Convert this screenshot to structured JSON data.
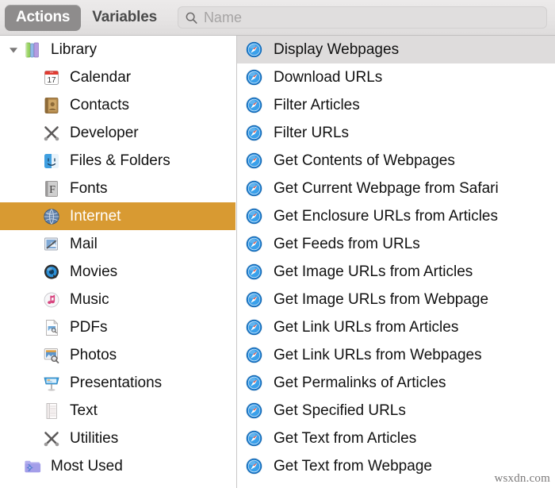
{
  "toolbar": {
    "tabs": [
      {
        "label": "Actions",
        "selected": true
      },
      {
        "label": "Variables",
        "selected": false
      }
    ],
    "search": {
      "placeholder": "Name",
      "value": "",
      "icon": "search-icon"
    }
  },
  "sidebar": {
    "items": [
      {
        "label": "Library",
        "icon": "library-books-icon",
        "level": 0,
        "expanded": true,
        "selected": false
      },
      {
        "label": "Calendar",
        "icon": "calendar-icon",
        "level": 1,
        "selected": false
      },
      {
        "label": "Contacts",
        "icon": "contacts-book-icon",
        "level": 1,
        "selected": false
      },
      {
        "label": "Developer",
        "icon": "developer-tools-icon",
        "level": 1,
        "selected": false
      },
      {
        "label": "Files & Folders",
        "icon": "finder-icon",
        "level": 1,
        "selected": false
      },
      {
        "label": "Fonts",
        "icon": "font-book-icon",
        "level": 1,
        "selected": false
      },
      {
        "label": "Internet",
        "icon": "globe-icon",
        "level": 1,
        "selected": true
      },
      {
        "label": "Mail",
        "icon": "mail-stamp-icon",
        "level": 1,
        "selected": false
      },
      {
        "label": "Movies",
        "icon": "quicktime-icon",
        "level": 1,
        "selected": false
      },
      {
        "label": "Music",
        "icon": "itunes-note-icon",
        "level": 1,
        "selected": false
      },
      {
        "label": "PDFs",
        "icon": "pdf-page-icon",
        "level": 1,
        "selected": false
      },
      {
        "label": "Photos",
        "icon": "photos-preview-icon",
        "level": 1,
        "selected": false
      },
      {
        "label": "Presentations",
        "icon": "presentation-icon",
        "level": 1,
        "selected": false
      },
      {
        "label": "Text",
        "icon": "textedit-icon",
        "level": 1,
        "selected": false
      },
      {
        "label": "Utilities",
        "icon": "utilities-tools-icon",
        "level": 1,
        "selected": false
      },
      {
        "label": "Most Used",
        "icon": "smart-folder-icon",
        "level": 0,
        "selected": false
      }
    ]
  },
  "actions": {
    "items": [
      {
        "label": "Display Webpages",
        "icon": "safari-compass-icon",
        "selected": true
      },
      {
        "label": "Download URLs",
        "icon": "safari-compass-icon",
        "selected": false
      },
      {
        "label": "Filter Articles",
        "icon": "safari-compass-icon",
        "selected": false
      },
      {
        "label": "Filter URLs",
        "icon": "safari-compass-icon",
        "selected": false
      },
      {
        "label": "Get Contents of Webpages",
        "icon": "safari-compass-icon",
        "selected": false
      },
      {
        "label": "Get Current Webpage from Safari",
        "icon": "safari-compass-icon",
        "selected": false
      },
      {
        "label": "Get Enclosure URLs from Articles",
        "icon": "safari-compass-icon",
        "selected": false
      },
      {
        "label": "Get Feeds from URLs",
        "icon": "safari-compass-icon",
        "selected": false
      },
      {
        "label": "Get Image URLs from Articles",
        "icon": "safari-compass-icon",
        "selected": false
      },
      {
        "label": "Get Image URLs from Webpage",
        "icon": "safari-compass-icon",
        "selected": false
      },
      {
        "label": "Get Link URLs from Articles",
        "icon": "safari-compass-icon",
        "selected": false
      },
      {
        "label": "Get Link URLs from Webpages",
        "icon": "safari-compass-icon",
        "selected": false
      },
      {
        "label": "Get Permalinks of Articles",
        "icon": "safari-compass-icon",
        "selected": false
      },
      {
        "label": "Get Specified URLs",
        "icon": "safari-compass-icon",
        "selected": false
      },
      {
        "label": "Get Text from Articles",
        "icon": "safari-compass-icon",
        "selected": false
      },
      {
        "label": "Get Text from Webpage",
        "icon": "safari-compass-icon",
        "selected": false
      }
    ]
  },
  "watermark": {
    "text": "wsxdn.com"
  },
  "colors": {
    "selection_orange": "#d89a32",
    "selection_gray": "#dedcdc",
    "tab_active": "#8e8c8c",
    "toolbar_bg": "#e6e4e4"
  }
}
